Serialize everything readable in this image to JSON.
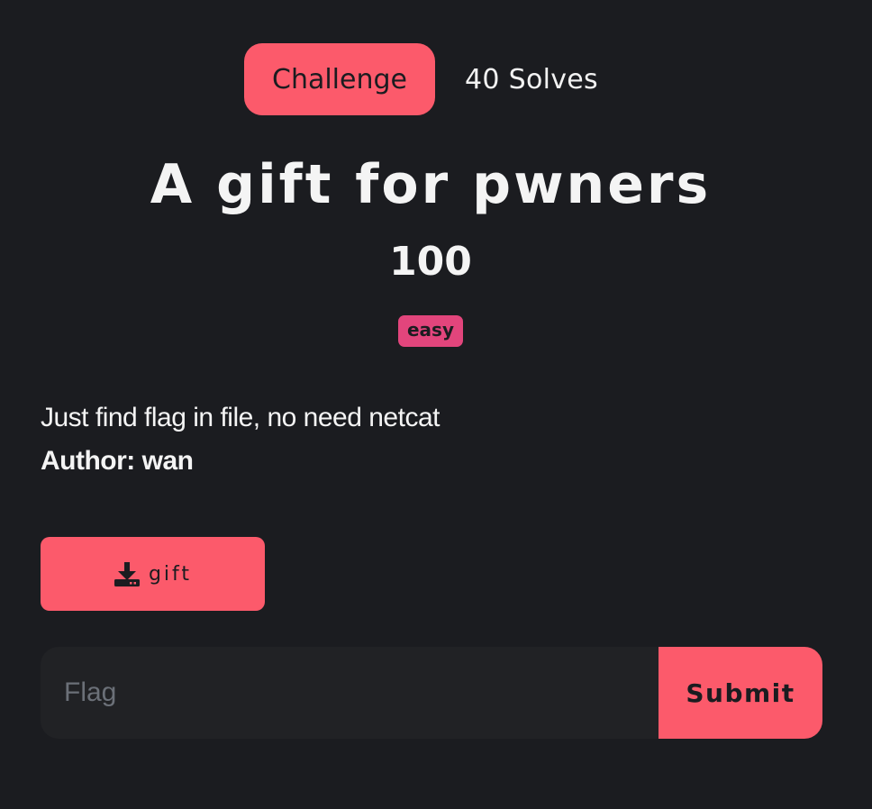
{
  "tabs": {
    "challenge_label": "Challenge",
    "solves_label": "40 Solves"
  },
  "challenge": {
    "name": "A gift for pwners",
    "value": "100",
    "tag": "easy",
    "description": "Just find flag in file, no need netcat",
    "author": "Author: wan"
  },
  "file": {
    "icon": "download-icon",
    "label": "gift"
  },
  "flag_form": {
    "placeholder": "Flag",
    "value": "",
    "submit_label": "Submit"
  },
  "colors": {
    "background": "#1b1c20",
    "accent": "#fc5a6b",
    "tag": "#e2457c",
    "input_bg": "#212225"
  }
}
